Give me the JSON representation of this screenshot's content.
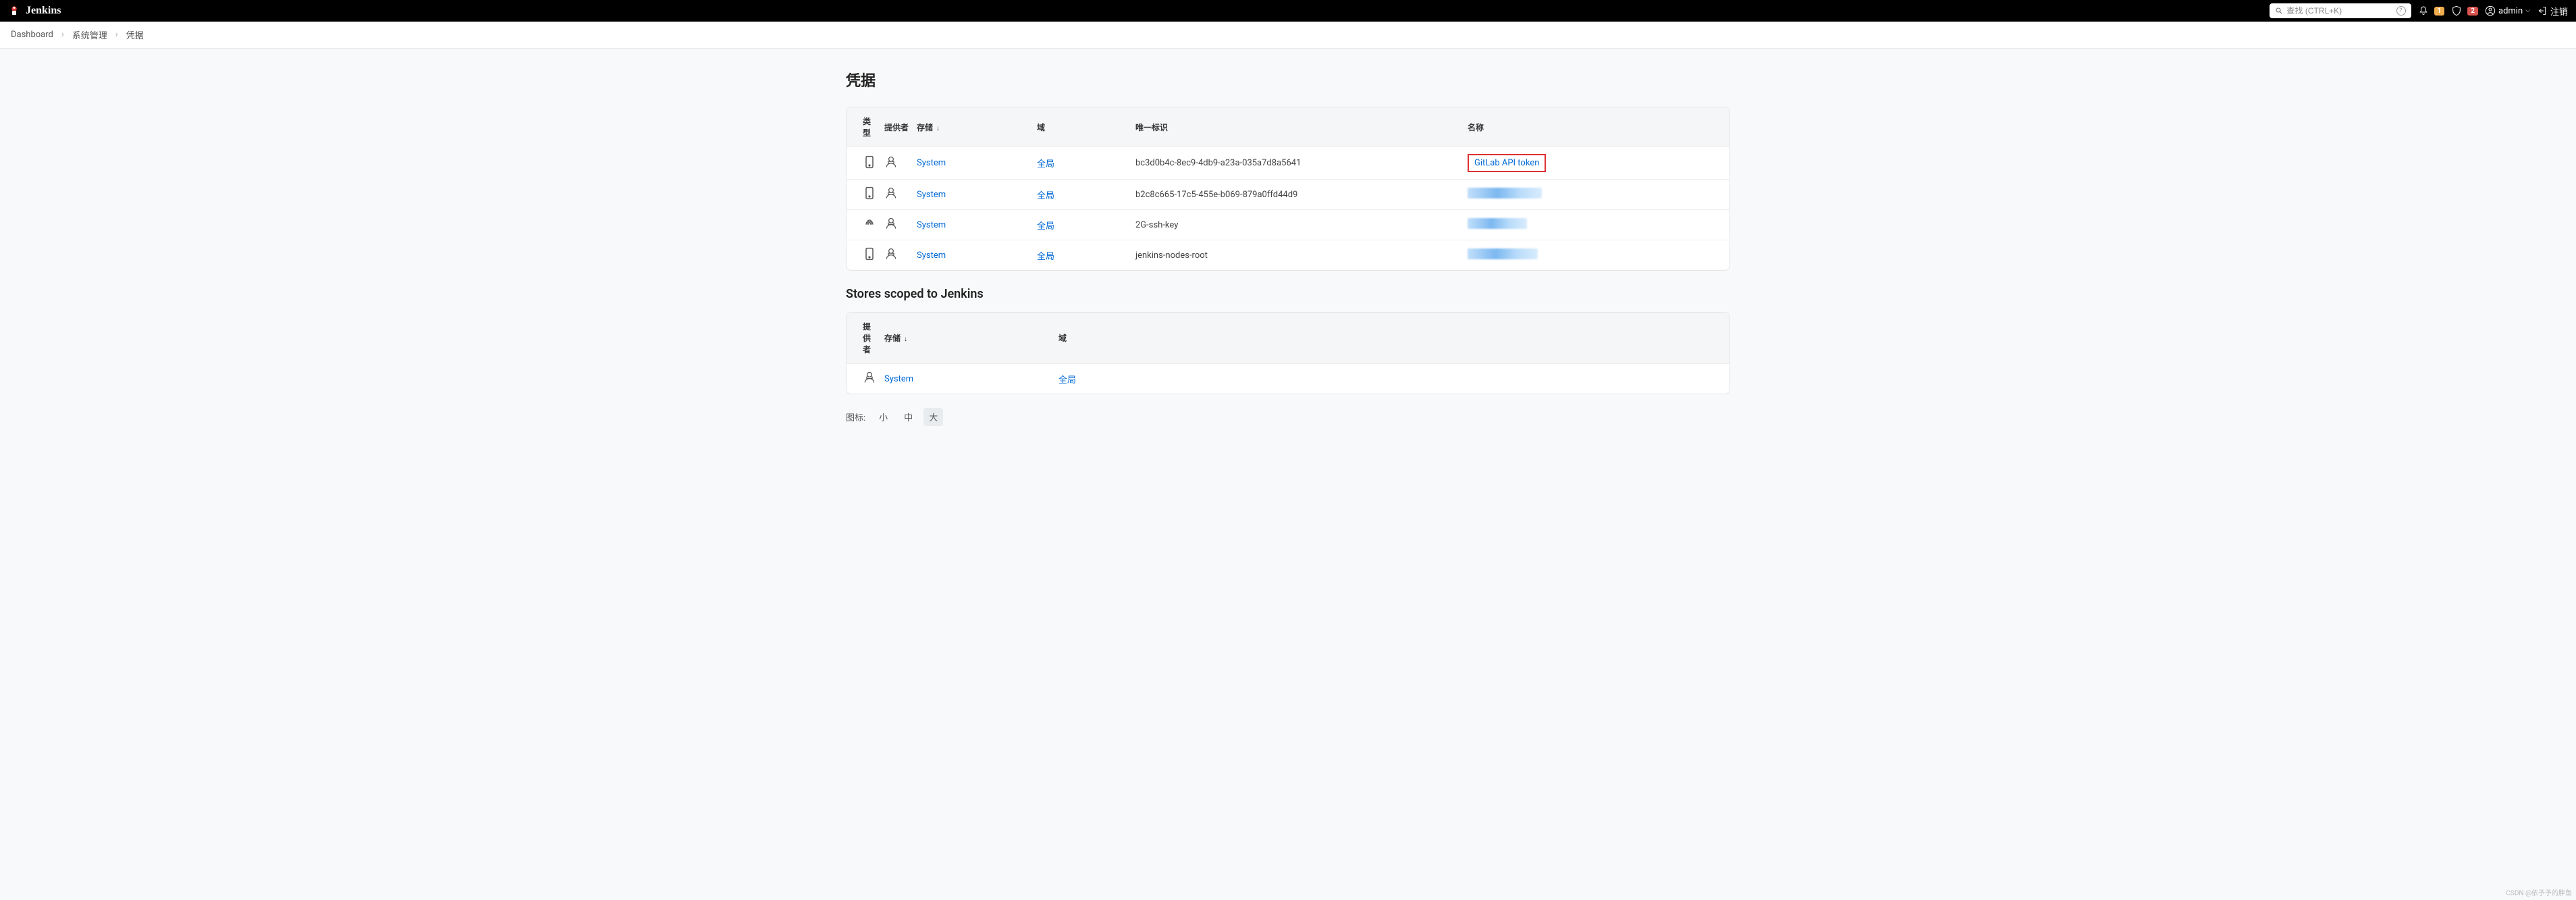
{
  "header": {
    "brand": "Jenkins",
    "search_placeholder": "查找 (CTRL+K)",
    "notif_badge": "1",
    "alert_badge": "2",
    "username": "admin",
    "logout": "注销"
  },
  "breadcrumb": {
    "items": [
      "Dashboard",
      "系统管理",
      "凭据"
    ]
  },
  "page": {
    "title": "凭据",
    "table1": {
      "headers": {
        "type": "类型",
        "provider": "提供者",
        "store": "存储",
        "sort": "↓",
        "domain": "域",
        "id": "唯一标识",
        "name": "名称"
      },
      "rows": [
        {
          "icon": "cred-token",
          "store": "System",
          "domain": "全局",
          "id": "bc3d0b4c-8ec9-4db9-a23a-035a7d8a5641",
          "name": "GitLab API token",
          "highlight": true
        },
        {
          "icon": "cred-token",
          "store": "System",
          "domain": "全局",
          "id": "b2c8c665-17c5-455e-b069-879a0ffd44d9",
          "name": "",
          "redacted_width": 110
        },
        {
          "icon": "cred-fingerprint",
          "store": "System",
          "domain": "全局",
          "id": "2G-ssh-key",
          "name": "",
          "redacted_width": 88
        },
        {
          "icon": "cred-token",
          "store": "System",
          "domain": "全局",
          "id": "jenkins-nodes-root",
          "name": "",
          "redacted_width": 104
        }
      ]
    },
    "section2_title": "Stores scoped to Jenkins",
    "table2": {
      "headers": {
        "provider": "提供者",
        "store": "存储",
        "sort": "↓",
        "domain": "域"
      },
      "rows": [
        {
          "store": "System",
          "domain": "全局"
        }
      ]
    },
    "iconsize": {
      "label": "图标:",
      "small": "小",
      "medium": "中",
      "large": "大"
    }
  },
  "footer_watermark": "CSDN @依予予的胖鱼"
}
